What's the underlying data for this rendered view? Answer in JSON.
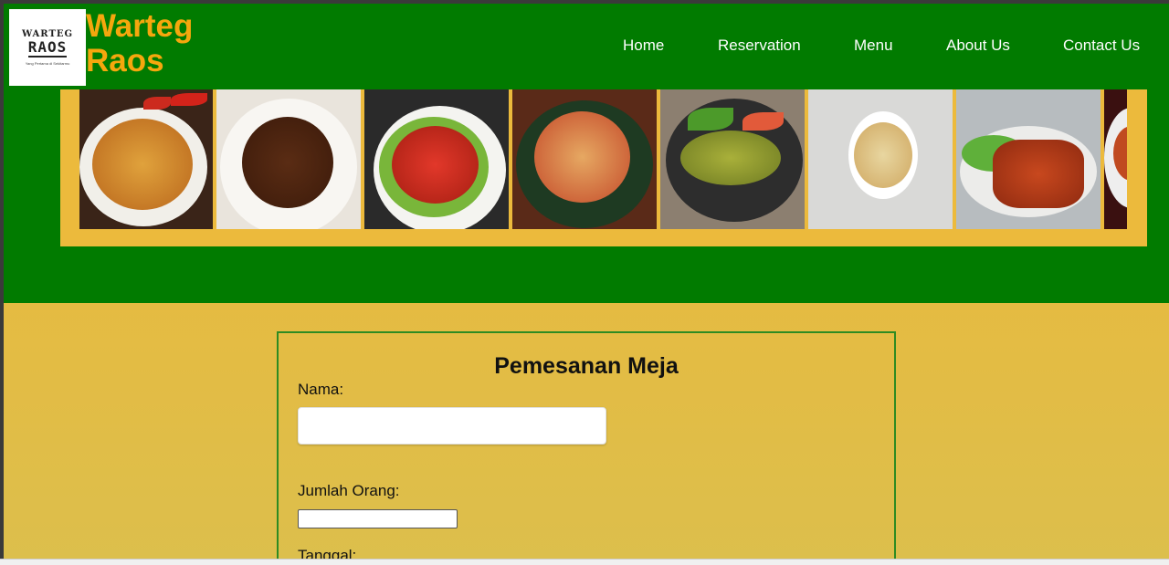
{
  "brand": {
    "logo_line1": "WARTEG",
    "logo_line2": "RAOS",
    "logo_line3": "Yang Pertama di Sekitarmu",
    "title_line1": "Warteg",
    "title_line2": "Raos"
  },
  "nav": {
    "items": [
      {
        "label": "Home"
      },
      {
        "label": "Reservation"
      },
      {
        "label": "Menu"
      },
      {
        "label": "About Us"
      },
      {
        "label": "Contact Us"
      }
    ]
  },
  "banner": {
    "dishes": [
      "mie-goreng",
      "sate",
      "balado",
      "sayur-pedas",
      "ikan-bakar",
      "sup-ayam",
      "dendeng-balado",
      "sayur-partial"
    ]
  },
  "form": {
    "title": "Pemesanan Meja",
    "nama_label": "Nama:",
    "nama_value": "",
    "jumlah_label": "Jumlah Orang:",
    "jumlah_value": "",
    "tanggal_label": "Tanggal:"
  },
  "colors": {
    "header_bg": "#017b00",
    "brand_text": "#f5a70d",
    "banner_bg": "#ecba3c",
    "page_bg": "#e2bc45",
    "form_border": "#2e8b22"
  }
}
